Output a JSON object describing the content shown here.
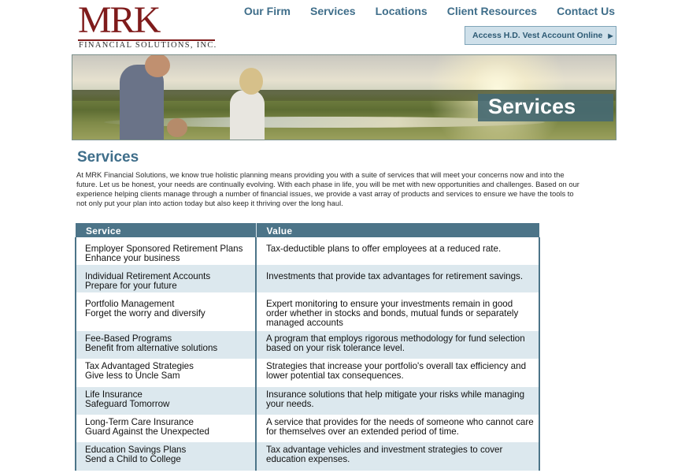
{
  "logo": {
    "letters": "MRK",
    "subtitle": "FINANCIAL SOLUTIONS, INC."
  },
  "nav": {
    "items": [
      "Our Firm",
      "Services",
      "Locations",
      "Client Resources",
      "Contact Us"
    ]
  },
  "account_button": {
    "label": "Access H.D. Vest Account Online",
    "icon": "triangle-right-icon"
  },
  "banner": {
    "label": "Services"
  },
  "page": {
    "title": "Services",
    "intro": "At MRK Financial Solutions, we know true holistic planning means providing you with a suite of services that will meet your concerns now and into the future. Let us be honest, your needs are continually evolving. With each phase in life, you will be met with new opportunities and challenges. Based on our experience helping clients manage through a number of financial issues, we provide a vast array of products and services to ensure we have the tools to not only put your plan into action today but also keep it thriving over the long haul."
  },
  "table": {
    "headers": [
      "Service",
      "Value"
    ],
    "rows": [
      {
        "service": "Employer Sponsored Retirement Plans",
        "tagline": "Enhance your business",
        "value": "Tax-deductible plans to offer employees at a reduced rate."
      },
      {
        "service": "Individual Retirement Accounts",
        "tagline": "Prepare for your future",
        "value": "Investments that provide tax advantages for retirement savings."
      },
      {
        "service": "Portfolio Management",
        "tagline": "Forget the worry and diversify",
        "value": "Expert monitoring to ensure your investments remain in good order whether in stocks and bonds, mutual funds or separately managed accounts"
      },
      {
        "service": "Fee-Based Programs",
        "tagline": "Benefit from alternative solutions",
        "value": "A program that employs rigorous methodology for fund selection based on your risk tolerance level."
      },
      {
        "service": "Tax Advantaged Strategies",
        "tagline": "Give less to Uncle Sam",
        "value": "Strategies that increase your portfolio's overall tax efficiency and lower potential tax consequences."
      },
      {
        "service": "Life Insurance",
        "tagline": "Safeguard Tomorrow",
        "value": "Insurance solutions that help mitigate your risks while managing your needs."
      },
      {
        "service": "Long-Term Care Insurance",
        "tagline": "Guard Against the Unexpected",
        "value": "A service that provides for the needs of someone who cannot care for themselves over an extended period of time."
      },
      {
        "service": "Education Savings Plans",
        "tagline": "Send a Child to College",
        "value": "Tax advantage vehicles and investment strategies to cover education expenses."
      }
    ]
  }
}
